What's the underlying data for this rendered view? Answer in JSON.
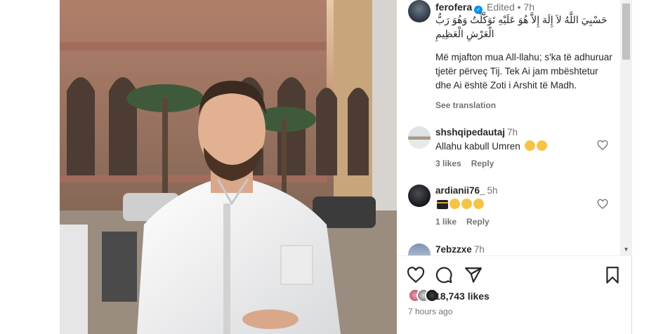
{
  "post": {
    "username": "ferofera",
    "verified_glyph": "✓",
    "edited": "Edited",
    "dot": "•",
    "time": "7h",
    "caption_arabic": "حَسْبِيَ اللَّهُ لاَ إِلَهَ إِلاَّ هُوَ عَلَيْهِ تَوَكَّلْتُ وَهُوَ رَبُّ الْعَرْشِ الْعَظِيمِ",
    "caption_text": "Më mjafton mua All-llahu; s'ka të adhuruar tjetër përveç Tij. Tek Ai jam mbështetur dhe Ai është Zoti i Arshit të Madh.",
    "see_translation": "See translation"
  },
  "comments": [
    {
      "username": "shshqipedautaj",
      "time": "7h",
      "text": "Allahu kabull Umren",
      "emojis": [
        "hands-icon",
        "hands-icon"
      ],
      "likes": "3 likes",
      "reply": "Reply"
    },
    {
      "username": "ardianii76_",
      "time": "5h",
      "text": "",
      "emojis": [
        "kaaba-icon",
        "hands-icon",
        "raised-hands-icon",
        "raised-hands-icon"
      ],
      "likes": "1 like",
      "reply": "Reply"
    },
    {
      "username": "7ebzzxe",
      "time": "7h"
    }
  ],
  "actions": {
    "likes": "18,743 likes",
    "ago": "7 hours ago",
    "icons": [
      "heart-icon",
      "comment-icon",
      "share-icon",
      "bookmark-icon"
    ]
  },
  "scrollbar": {
    "up": "▲",
    "down": "▼"
  },
  "colors": {
    "link": "#0095f6",
    "muted": "#737373",
    "text": "#262626"
  }
}
